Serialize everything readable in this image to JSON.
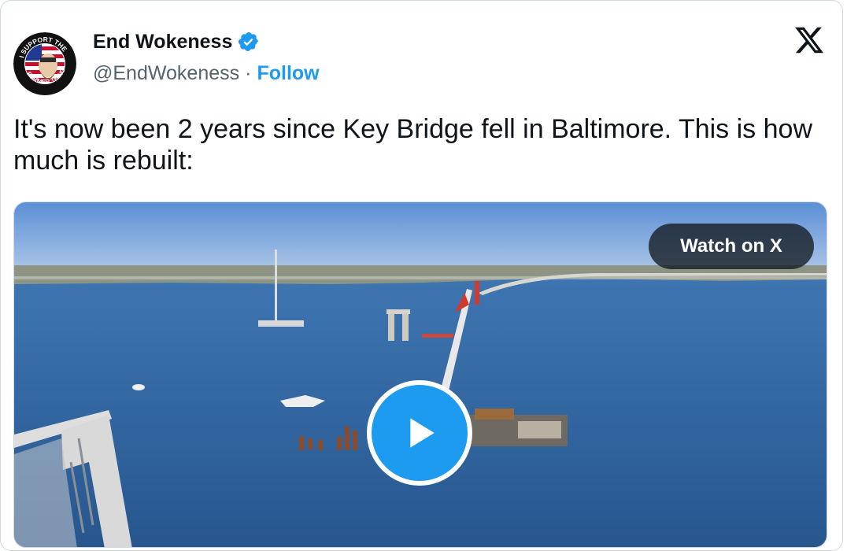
{
  "author": {
    "name": "End Wokeness",
    "handle": "@EndWokeness",
    "separator": "·",
    "follow_label": "Follow",
    "avatar_text_top": "I SUPPORT THE",
    "avatar_text_bottom": "FORMER THINGS",
    "verified_color": "#1d9bf0"
  },
  "tweet": {
    "text": "It's now been 2 years since Key Bridge fell in Baltimore. This is how much is rebuilt:"
  },
  "media": {
    "watch_label": "Watch on X",
    "play_icon": "play-icon",
    "accent": "#1d9bf0"
  },
  "icons": {
    "close": "x-logo-icon",
    "verified": "verified-badge-icon"
  }
}
